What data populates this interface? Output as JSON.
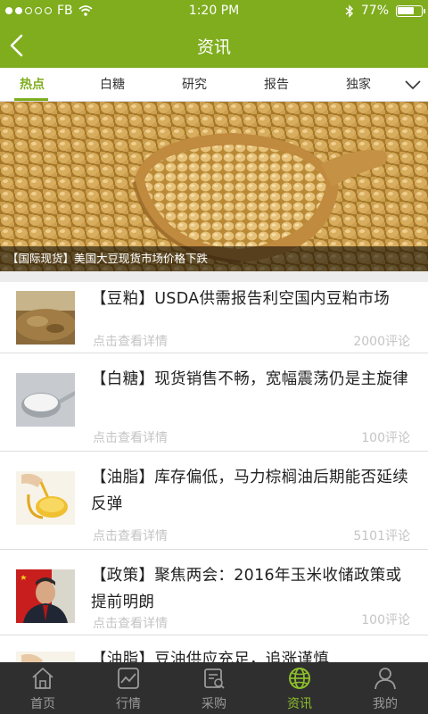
{
  "status_bar": {
    "carrier": "FB",
    "time": "1:20 PM",
    "battery": "77%",
    "battery_level": 0.77
  },
  "header": {
    "title": "资讯"
  },
  "tabs": [
    {
      "label": "热点",
      "active": true
    },
    {
      "label": "白糖",
      "active": false
    },
    {
      "label": "研究",
      "active": false
    },
    {
      "label": "报告",
      "active": false
    },
    {
      "label": "独家",
      "active": false
    }
  ],
  "banner": {
    "caption": "【国际现货】美国大豆现货市场价格下跌"
  },
  "news": [
    {
      "title": "【豆粕】USDA供需报告利空国内豆粕市场",
      "more": "点击查看详情",
      "count": "2000评论",
      "thumb": "soybean-meal-thumbnail"
    },
    {
      "title": "【白糖】现货销售不畅，宽幅震荡仍是主旋律",
      "more": "点击查看详情",
      "count": "100评论",
      "thumb": "sugar-spoon-thumbnail"
    },
    {
      "title": "【油脂】库存偏低，马力棕榈油后期能否延续反弹",
      "more": "点击查看详情",
      "count": "5101评论",
      "thumb": "oil-pour-thumbnail"
    },
    {
      "title": "【政策】聚焦两会：2016年玉米收储政策或提前明朗",
      "more": "点击查看详情",
      "count": "100评论",
      "thumb": "person-flag-thumbnail"
    },
    {
      "title": "【油脂】豆油供应充足，追涨谨慎",
      "more": "",
      "count": "",
      "thumb": "oil-pour-thumbnail"
    }
  ],
  "bottom_nav": [
    {
      "label": "首页",
      "icon": "home-icon",
      "active": false
    },
    {
      "label": "行情",
      "icon": "chart-icon",
      "active": false
    },
    {
      "label": "采购",
      "icon": "purchase-icon",
      "active": false
    },
    {
      "label": "资讯",
      "icon": "globe-icon",
      "active": true
    },
    {
      "label": "我的",
      "icon": "user-icon",
      "active": false
    }
  ],
  "colors": {
    "brand_green": "#7fad1e",
    "bottom_bar": "#2f2f2f",
    "active_tab_label": "#8cbf2a"
  }
}
